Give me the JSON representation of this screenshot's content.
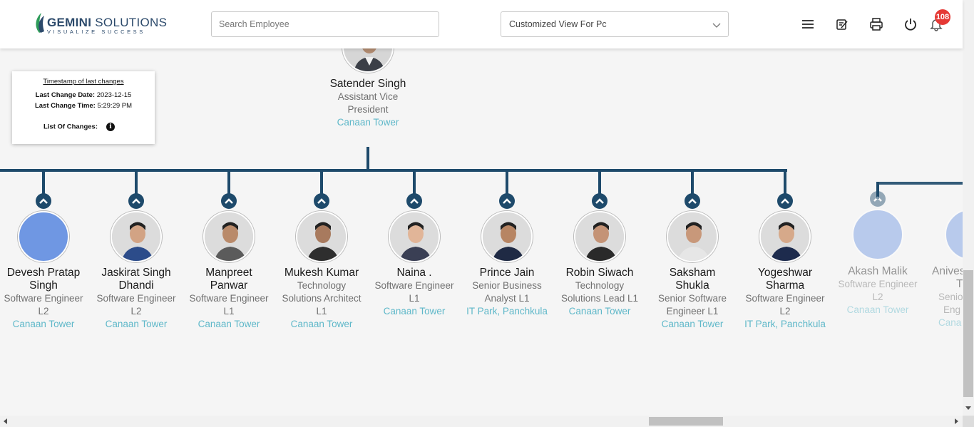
{
  "header": {
    "logo_title_bold": "GEMINI",
    "logo_title_rest": "SOLUTIONS",
    "logo_tagline": "VISUALIZE SUCCESS",
    "search_placeholder": "Search Employee",
    "view_select": "Customized View For Pc",
    "notification_count": "108",
    "icons": [
      "menu-icon",
      "edit-note-icon",
      "print-icon",
      "power-icon",
      "bell-icon"
    ]
  },
  "timestamp_box": {
    "title": "Timestamp of last changes",
    "date_label": "Last Change Date:",
    "date_value": "2023-12-15",
    "time_label": "Last Change Time:",
    "time_value": "5:29:29 PM",
    "changes_label": "List Of Changes:"
  },
  "manager": {
    "name": "Satender Singh",
    "title_line1": "Assistant Vice",
    "title_line2": "President",
    "location": "Canaan Tower"
  },
  "reports": [
    {
      "name": [
        "Devesh Pratap",
        "Singh"
      ],
      "title": [
        "Software Engineer",
        "L2"
      ],
      "location": "Canaan Tower"
    },
    {
      "name": [
        "Jaskirat Singh",
        "Dhandi"
      ],
      "title": [
        "Software Engineer",
        "L2"
      ],
      "location": "Canaan Tower"
    },
    {
      "name": [
        "Manpreet",
        "Panwar"
      ],
      "title": [
        "Software Engineer",
        "L1"
      ],
      "location": "Canaan Tower"
    },
    {
      "name": [
        "Mukesh Kumar"
      ],
      "title": [
        "Technology",
        "Solutions Architect",
        "L1"
      ],
      "location": "Canaan Tower"
    },
    {
      "name": [
        "Naina ."
      ],
      "title": [
        "Software Engineer",
        "L1"
      ],
      "location": "Canaan Tower"
    },
    {
      "name": [
        "Prince Jain"
      ],
      "title": [
        "Senior Business",
        "Analyst L1"
      ],
      "location": "IT Park, Panchkula"
    },
    {
      "name": [
        "Robin Siwach"
      ],
      "title": [
        "Technology",
        "Solutions Lead L1"
      ],
      "location": "Canaan Tower"
    },
    {
      "name": [
        "Saksham",
        "Shukla"
      ],
      "title": [
        "Senior Software",
        "Engineer L1"
      ],
      "location": "Canaan Tower"
    },
    {
      "name": [
        "Yogeshwar",
        "Sharma"
      ],
      "title": [
        "Software Engineer",
        "L2"
      ],
      "location": "IT Park, Panchkula"
    }
  ],
  "faded_reports": [
    {
      "name": "Akash Malik",
      "title": [
        "Software Engineer",
        "L2"
      ],
      "location": "Canaan Tower"
    },
    {
      "name": "Anives",
      "name2": "T",
      "title": [
        "Senio",
        "Eng"
      ],
      "location": "Cana"
    }
  ],
  "colors": {
    "connector": "#1e4a6b",
    "location": "#5fb8c9",
    "badge": "#e53935",
    "placeholder_avatar": "#6f97e3"
  }
}
